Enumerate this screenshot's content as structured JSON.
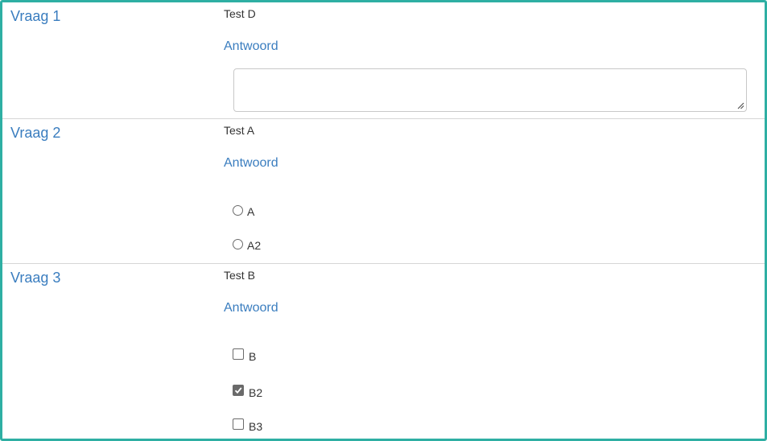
{
  "questions": [
    {
      "label": "Vraag 1",
      "text": "Test D",
      "answer_label": "Antwoord",
      "answer_type": "textarea",
      "value": ""
    },
    {
      "label": "Vraag 2",
      "text": "Test A",
      "answer_label": "Antwoord",
      "answer_type": "radio",
      "options": [
        {
          "label": "A",
          "checked": false
        },
        {
          "label": "A2",
          "checked": false
        }
      ]
    },
    {
      "label": "Vraag 3",
      "text": "Test B",
      "answer_label": "Antwoord",
      "answer_type": "checkbox",
      "options": [
        {
          "label": "B",
          "checked": false
        },
        {
          "label": "B2",
          "checked": true
        },
        {
          "label": "B3",
          "checked": false
        }
      ]
    }
  ],
  "colors": {
    "frame_border": "#2eafa3",
    "accent": "#3a7dbf",
    "checked_fill": "#6a6a6a"
  }
}
